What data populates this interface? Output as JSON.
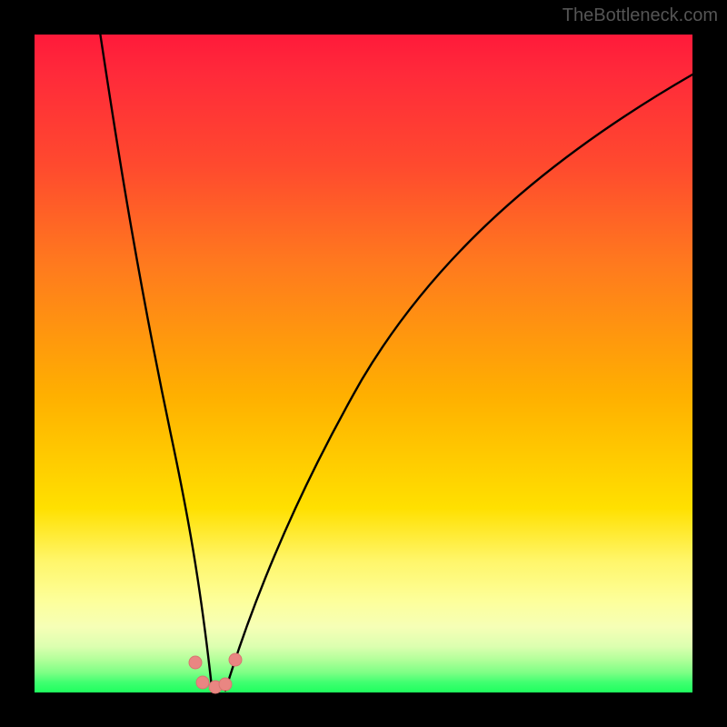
{
  "watermark": "TheBottleneck.com",
  "colors": {
    "frame": "#000000",
    "curve": "#000000",
    "marker_fill": "#e98682",
    "marker_stroke": "#d87470"
  },
  "chart_data": {
    "type": "line",
    "title": "",
    "xlabel": "",
    "ylabel": "",
    "xlim": [
      0,
      100
    ],
    "ylim": [
      0,
      100
    ],
    "grid": false,
    "legend": false,
    "notes": "x is horizontal position (% of plot width, left→right), y is vertical position (% of plot height, bottom→top). Two black curves form a V/check shape; a few salmon circular markers sit near the bottom of the V.",
    "series": [
      {
        "name": "left-arm",
        "x": [
          10,
          13,
          16,
          19,
          22,
          25,
          27
        ],
        "y": [
          100,
          82,
          64,
          45,
          27,
          8,
          0
        ]
      },
      {
        "name": "right-arm",
        "x": [
          29,
          32,
          36,
          42,
          50,
          60,
          72,
          86,
          100
        ],
        "y": [
          0,
          10,
          22,
          36,
          50,
          62,
          74,
          85,
          94
        ]
      }
    ],
    "markers": {
      "name": "bottom-cluster",
      "color": "#e98682",
      "points": [
        {
          "x": 24.5,
          "y": 4.5
        },
        {
          "x": 25.5,
          "y": 1.5
        },
        {
          "x": 27.5,
          "y": 0.8
        },
        {
          "x": 29.0,
          "y": 1.3
        },
        {
          "x": 30.5,
          "y": 5.0
        }
      ]
    }
  }
}
